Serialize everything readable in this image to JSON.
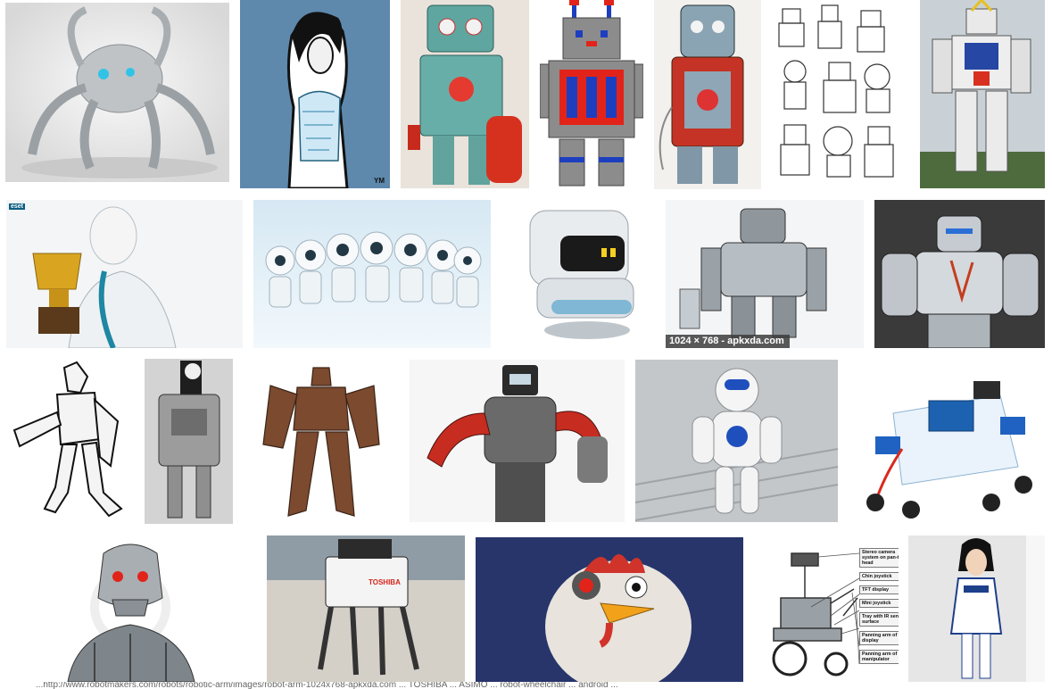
{
  "results": {
    "hover_size_label": "1024 × 768 - apkxda.com",
    "thumb_logo_text": "eset",
    "thumb_watermark": "YM",
    "toshiba_label": "TOSHIBA",
    "wheelchair_callouts": [
      "Stereo camera system on pan-tilt-head",
      "Chin joystick",
      "TFT display",
      "Mini joystick",
      "Tray with IR sensor surface",
      "Panning arm of TFT display",
      "Panning arm of manipulator"
    ],
    "status_url_strip": "...http://www.robotmakers.com/robots/robotic-arm/images/robot-arm-1024x768-apkxda.com ... TOSHIBA ... ASIMO ... robot-wheelchair ... android ..."
  }
}
